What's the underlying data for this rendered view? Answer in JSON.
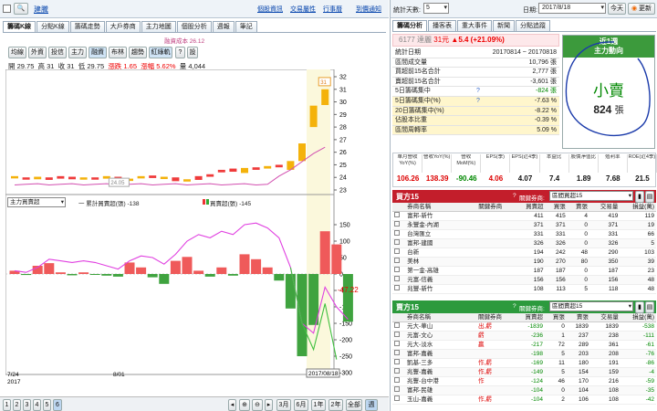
{
  "top": {
    "checkbox_label": "",
    "stock_name": "建騰",
    "links": [
      "個股資訊",
      "交易屬性",
      "行事曆",
      "到價通知"
    ]
  },
  "left_tabs": [
    "籌碼K線",
    "分點K線",
    "籌碼走勢",
    "大戶券商",
    "主力地圖",
    "個股分析",
    "週報",
    "筆記"
  ],
  "toolbar": {
    "buttons": [
      "均線",
      "外資",
      "投信",
      "主力",
      "融資",
      "布林",
      "趨勢",
      "紅綠軌"
    ],
    "right": "設",
    "avg_label": "融資成本 26.12"
  },
  "ohlc": {
    "open_l": "開",
    "open": "29.75",
    "high_l": "高",
    "high": "31",
    "close_l": "收",
    "close": "31",
    "low_l": "低",
    "low": "29.75",
    "chg_l": "漲跌",
    "chg": "1.65",
    "pct_l": "漲幅",
    "pct": "5.62%",
    "vol_l": "量",
    "vol": "4,044"
  },
  "price_axis": [
    "32",
    "31",
    "30",
    "29",
    "28",
    "27",
    "26",
    "25",
    "24",
    "23"
  ],
  "low_tag": "24.05",
  "high_tag": "31",
  "indicator": {
    "select": "主力買賣超",
    "legend_line": "一 累計買賣超(張) -138",
    "legend_bar": "買賣超(張) -145",
    "last_value": "-47.22"
  },
  "ind_axis": [
    "150",
    "100",
    "50",
    "0",
    "-50",
    "-100",
    "-150",
    "-200",
    "-250",
    "-300"
  ],
  "x_axis": {
    "start": "7/24",
    "year": "2017",
    "mid": "8/01",
    "end": "2017/08/18"
  },
  "bottom_pages": [
    "1",
    "2",
    "3",
    "4",
    "5",
    "6"
  ],
  "bottom_ranges": [
    "3月",
    "6月",
    "1年",
    "2年",
    "全部",
    "週"
  ],
  "right_top": {
    "days_label": "統計天數:",
    "days": "5",
    "date_label": "日期:",
    "date": "2017/8/18",
    "today": "今天",
    "refresh": "更新"
  },
  "right_tabs": [
    "籌碼分析",
    "播客表",
    "重大事件",
    "新聞",
    "分點追蹤"
  ],
  "stock": {
    "code": "6177",
    "name": "達麗",
    "price": "31元",
    "change": "▲5.4 (+21.09%)"
  },
  "stats": [
    [
      "統計日期",
      "20170814 ~ 20170818"
    ],
    [
      "區間成交量",
      "10,796 張"
    ],
    [
      "買超前15名合計",
      "2,777 張"
    ],
    [
      "賣超前15名合計",
      "-3,601 張"
    ],
    [
      "5日籌碼集中",
      "-824 張"
    ],
    [
      "5日籌碼集中(%)",
      "-7.63 %"
    ],
    [
      "20日籌碼集中(%)",
      "-8.22 %"
    ],
    [
      "佔股本比重",
      "-0.39 %"
    ],
    [
      "區間周轉率",
      "5.09 %"
    ]
  ],
  "trend_box": {
    "line1": "近1週",
    "line2": "主力動向",
    "big": "小賣",
    "count": "824",
    "unit": "張"
  },
  "metrics": {
    "headers": [
      "單月營收YoY(%)",
      "營收YoY(%)",
      "營收MoM(%)",
      "EPS(季)",
      "EPS(近4季)",
      "本益比",
      "股價淨值比",
      "殖利率",
      "ROE(近4季)"
    ],
    "values": [
      "106.26",
      "138.39",
      "-90.46",
      "4.06",
      "4.07",
      "7.4",
      "1.89",
      "7.68",
      "21.5"
    ]
  },
  "buy": {
    "title": "買方15",
    "filter_label": "關鍵券商:",
    "filter": "區間買超15",
    "headers": [
      "",
      "券商名稱",
      "關鍵券商",
      "買賣超",
      "買張",
      "賣張",
      "交易量",
      "損益(萬)"
    ],
    "rows": [
      [
        "富邦-新竹",
        "",
        411,
        415,
        4,
        419,
        "119"
      ],
      [
        "永豐金-內湖",
        "",
        371,
        371,
        0,
        371,
        "19"
      ],
      [
        "台灣匯立",
        "",
        331,
        331,
        0,
        331,
        "66"
      ],
      [
        "富邦-建國",
        "",
        326,
        326,
        0,
        326,
        "5"
      ],
      [
        "台新",
        "",
        194,
        242,
        48,
        290,
        "103"
      ],
      [
        "美林",
        "",
        190,
        270,
        80,
        350,
        "39"
      ],
      [
        "第一金-高雄",
        "",
        187,
        187,
        0,
        187,
        "23"
      ],
      [
        "元富-信義",
        "",
        156,
        156,
        0,
        156,
        "48"
      ],
      [
        "兆豐-新竹",
        "",
        108,
        113,
        5,
        118,
        "48"
      ]
    ]
  },
  "sell": {
    "title": "賣方15",
    "filter_label": "關鍵券商:",
    "filter": "區間賣超15",
    "headers": [
      "",
      "券商名稱",
      "關鍵券商",
      "買賣超",
      "買張",
      "賣張",
      "交易量",
      "損益(萬)"
    ],
    "rows": [
      [
        "元大-華山",
        "出,虧",
        -1839,
        0,
        1839,
        1839,
        "-538"
      ],
      [
        "元富-文心",
        "虧",
        -236,
        1,
        237,
        238,
        "-111"
      ],
      [
        "元大-淡水",
        "贏",
        -217,
        72,
        289,
        361,
        "-61"
      ],
      [
        "富邦-嘉義",
        "",
        -198,
        5,
        203,
        208,
        "-76"
      ],
      [
        "凱基-三多",
        "作,虧",
        -169,
        11,
        180,
        191,
        "-86"
      ],
      [
        "兆豐-嘉義",
        "作,虧",
        -149,
        5,
        154,
        159,
        "-4"
      ],
      [
        "兆豐-台中港",
        "作",
        -124,
        46,
        170,
        216,
        "-59"
      ],
      [
        "富邦-民雄",
        "",
        -104,
        0,
        104,
        108,
        "-35"
      ],
      [
        "玉山-嘉義",
        "作,虧",
        -104,
        2,
        106,
        108,
        "-42"
      ]
    ]
  }
}
